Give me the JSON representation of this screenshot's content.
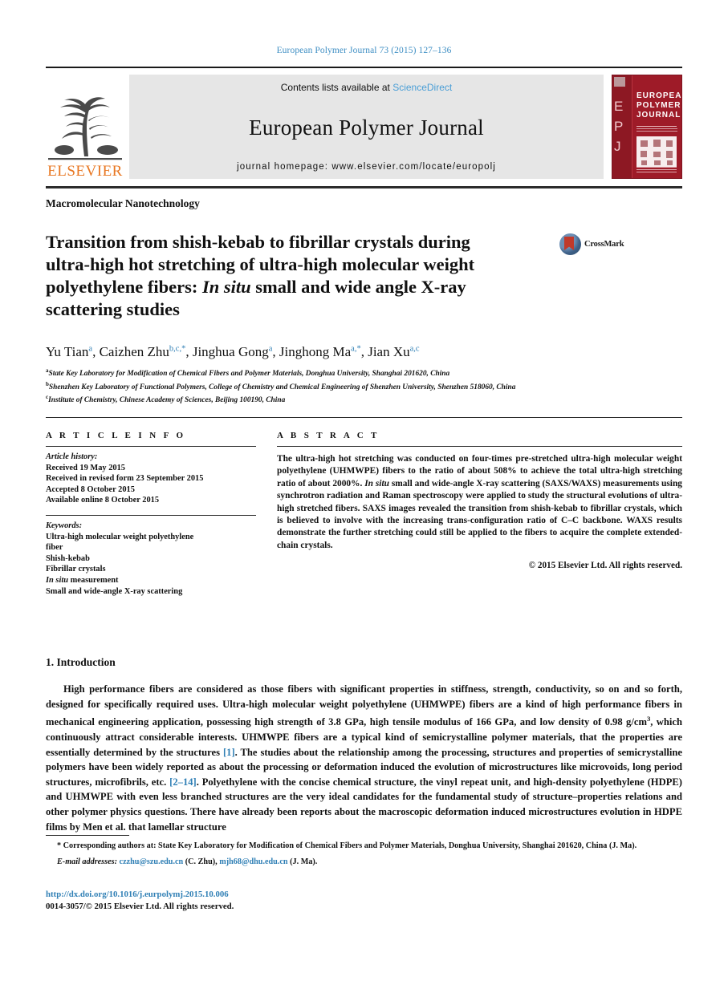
{
  "running_head": "European Polymer Journal 73 (2015) 127–136",
  "masthead": {
    "publisher_name": "ELSEVIER",
    "contents_prefix": "Contents lists available at",
    "contents_link": "ScienceDirect",
    "journal_name": "European Polymer Journal",
    "homepage_line": "journal homepage: www.elsevier.com/locate/europolj",
    "cover": {
      "spine_letters": "E\nP\nJ",
      "title_line1": "EUROPEAN",
      "title_line2": "POLYMER",
      "title_line3": "JOURNAL"
    }
  },
  "article": {
    "section_tag": "Macromolecular Nanotechnology",
    "title_line1": "Transition from shish-kebab to fibrillar crystals during",
    "title_line2": "ultra-high hot stretching of ultra-high molecular weight",
    "title_line3_a": "polyethylene fibers: ",
    "title_line3_it": "In situ",
    "title_line3_b": " small and wide angle X-ray",
    "title_line4": "scattering studies",
    "crossmark_label": "CrossMark",
    "authors": [
      {
        "name": "Yu Tian",
        "marks": "a",
        "sep": ", "
      },
      {
        "name": "Caizhen Zhu",
        "marks": "b,c,*",
        "sep": ", "
      },
      {
        "name": "Jinghua Gong",
        "marks": "a",
        "sep": ", "
      },
      {
        "name": "Jinghong Ma",
        "marks": "a,*",
        "sep": ", "
      },
      {
        "name": "Jian Xu",
        "marks": "a,c",
        "sep": ""
      }
    ],
    "affiliations": [
      {
        "mark": "a",
        "text": "State Key Laboratory for Modification of Chemical Fibers and Polymer Materials, Donghua University, Shanghai 201620, China"
      },
      {
        "mark": "b",
        "text": "Shenzhen Key Laboratory of Functional Polymers, College of Chemistry and Chemical Engineering of Shenzhen University, Shenzhen 518060, China"
      },
      {
        "mark": "c",
        "text": "Institute of Chemistry, Chinese Academy of Sciences, Beijing 100190, China"
      }
    ]
  },
  "article_info": {
    "heading": "A R T I C L E  I N F O",
    "history_label": "Article history:",
    "history": [
      "Received 19 May 2015",
      "Received in revised form 23 September 2015",
      "Accepted 8 October 2015",
      "Available online 8 October 2015"
    ],
    "keywords_label": "Keywords:",
    "keywords": [
      "Ultra-high molecular weight polyethylene",
      "fiber",
      "Shish-kebab",
      "Fibrillar crystals",
      "In situ measurement",
      "Small and wide-angle X-ray scattering"
    ],
    "keyword_italic_index": 4
  },
  "abstract": {
    "heading": "A B S T R A C T",
    "part1": "The ultra-high hot stretching was conducted on four-times pre-stretched ultra-high molecular weight polyethylene (UHMWPE) fibers to the ratio of about 508% to achieve the total ultra-high stretching ratio of about 2000%. ",
    "insitu": "In situ",
    "part2": " small and wide-angle X-ray scattering (SAXS/WAXS) measurements using synchrotron radiation and Raman spectroscopy were applied to study the structural evolutions of ultra-high stretched fibers. SAXS images revealed the transition from shish-kebab to fibrillar crystals, which is believed to involve with the increasing trans-configuration ratio of C–C backbone. WAXS results demonstrate the further stretching could still be applied to the fibers to acquire the complete extended-chain crystals.",
    "copyright": "© 2015 Elsevier Ltd. All rights reserved."
  },
  "introduction": {
    "heading": "1. Introduction",
    "p1_a": "High performance fibers are considered as those fibers with significant properties in stiffness, strength, conductivity, so on and so forth, designed for specifically required uses. Ultra-high molecular weight polyethylene (UHMWPE) fibers are a kind of high performance fibers in mechanical engineering application, possessing high strength of 3.8 GPa, high tensile modulus of 166 GPa, and low density of 0.98 g/cm",
    "p1_sup": "3",
    "p1_b": ", which continuously attract considerable interests. UHMWPE fibers are a typical kind of semicrystalline polymer materials, that the properties are essentially determined by the structures ",
    "p1_ref1": "[1]",
    "p1_c": ". The studies about the relationship among the processing, structures and properties of semicrystalline polymers have been widely reported as about the processing or deformation induced the evolution of microstructures like microvoids, long period structures, microfibrils, etc. ",
    "p1_ref2": "[2–14]",
    "p1_d": ". Polyethylene with the concise chemical structure, the vinyl repeat unit, and high-density polyethylene (HDPE) and UHMWPE with even less branched structures are the very ideal candidates for the fundamental study of structure–properties relations and other polymer physics questions. There have already been reports about the macroscopic deformation induced microstructures evolution in HDPE films by Men et al. that lamellar structure"
  },
  "footnotes": {
    "corresponding": "* Corresponding authors at: State Key Laboratory for Modification of Chemical Fibers and Polymer Materials, Donghua University, Shanghai 201620, China (J. Ma).",
    "email_label": "E-mail addresses:",
    "email1": "czzhu@szu.edu.cn",
    "email1_owner": " (C. Zhu), ",
    "email2": "mjh68@dhu.edu.cn",
    "email2_owner": " (J. Ma)."
  },
  "footer": {
    "doi": "http://dx.doi.org/10.1016/j.eurpolymj.2015.10.006",
    "issn_line": "0014-3057/© 2015 Elsevier Ltd. All rights reserved."
  },
  "colors": {
    "link_blue": "#2f7fb5",
    "runhead_blue": "#3f8fc4",
    "sciencedirect_blue": "#4a9ed6",
    "elsevier_orange": "#E87722",
    "cover_red": "#9e1b28",
    "band_gray": "#e6e6e6"
  }
}
